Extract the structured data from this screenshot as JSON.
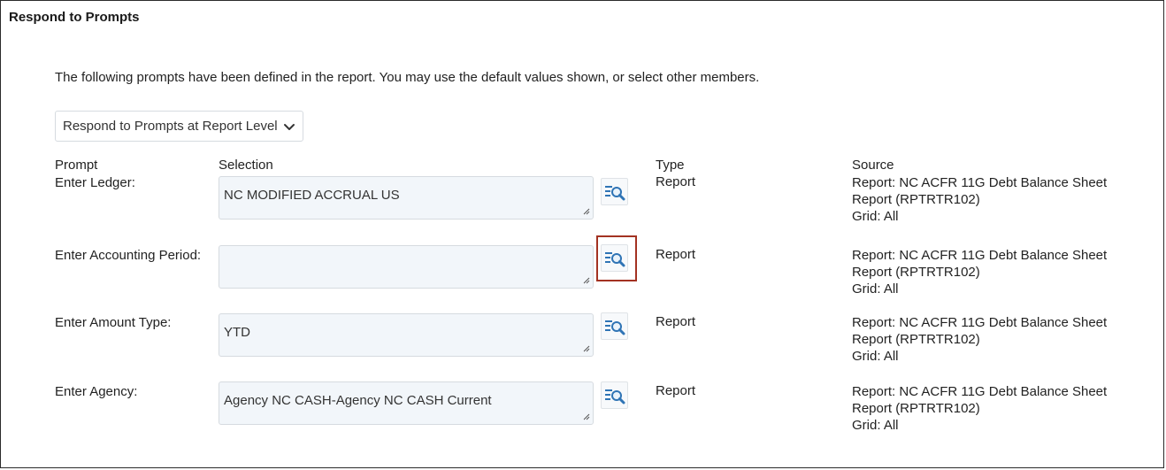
{
  "title": "Respond to Prompts",
  "intro": "The following prompts have been defined in the report. You may use the default values shown, or select other members.",
  "level_select": {
    "value": "Respond to Prompts at Report Level"
  },
  "headers": {
    "prompt": "Prompt",
    "selection": "Selection",
    "type": "Type",
    "source": "Source"
  },
  "rows": [
    {
      "label": "Enter Ledger:",
      "value": "NC MODIFIED ACCRUAL US",
      "type": "Report",
      "source": {
        "line1": "Report: NC ACFR 11G Debt Balance Sheet",
        "line2": "Report (RPTRTR102)",
        "line3": "Grid: All"
      }
    },
    {
      "label": "Enter Accounting Period:",
      "value": "",
      "type": "Report",
      "source": {
        "line1": "Report: NC ACFR 11G Debt Balance Sheet",
        "line2": "Report (RPTRTR102)",
        "line3": "Grid: All"
      }
    },
    {
      "label": "Enter Amount Type:",
      "value": "YTD",
      "type": "Report",
      "source": {
        "line1": "Report: NC ACFR 11G Debt Balance Sheet",
        "line2": "Report (RPTRTR102)",
        "line3": "Grid: All"
      }
    },
    {
      "label": "Enter Agency:",
      "value": "Agency NC CASH-Agency NC CASH Current",
      "type": "Report",
      "source": {
        "line1": "Report: NC ACFR 11G Debt Balance Sheet",
        "line2": "Report (RPTRTR102)",
        "line3": "Grid: All"
      }
    }
  ],
  "icons": {
    "search": "search-members-icon",
    "select_chevron": "chevron-down-icon",
    "resize": "resize-grip-icon"
  },
  "colors": {
    "highlight": "#a33222",
    "icon_blue": "#2f74b5",
    "field_bg": "#f2f6fa"
  }
}
